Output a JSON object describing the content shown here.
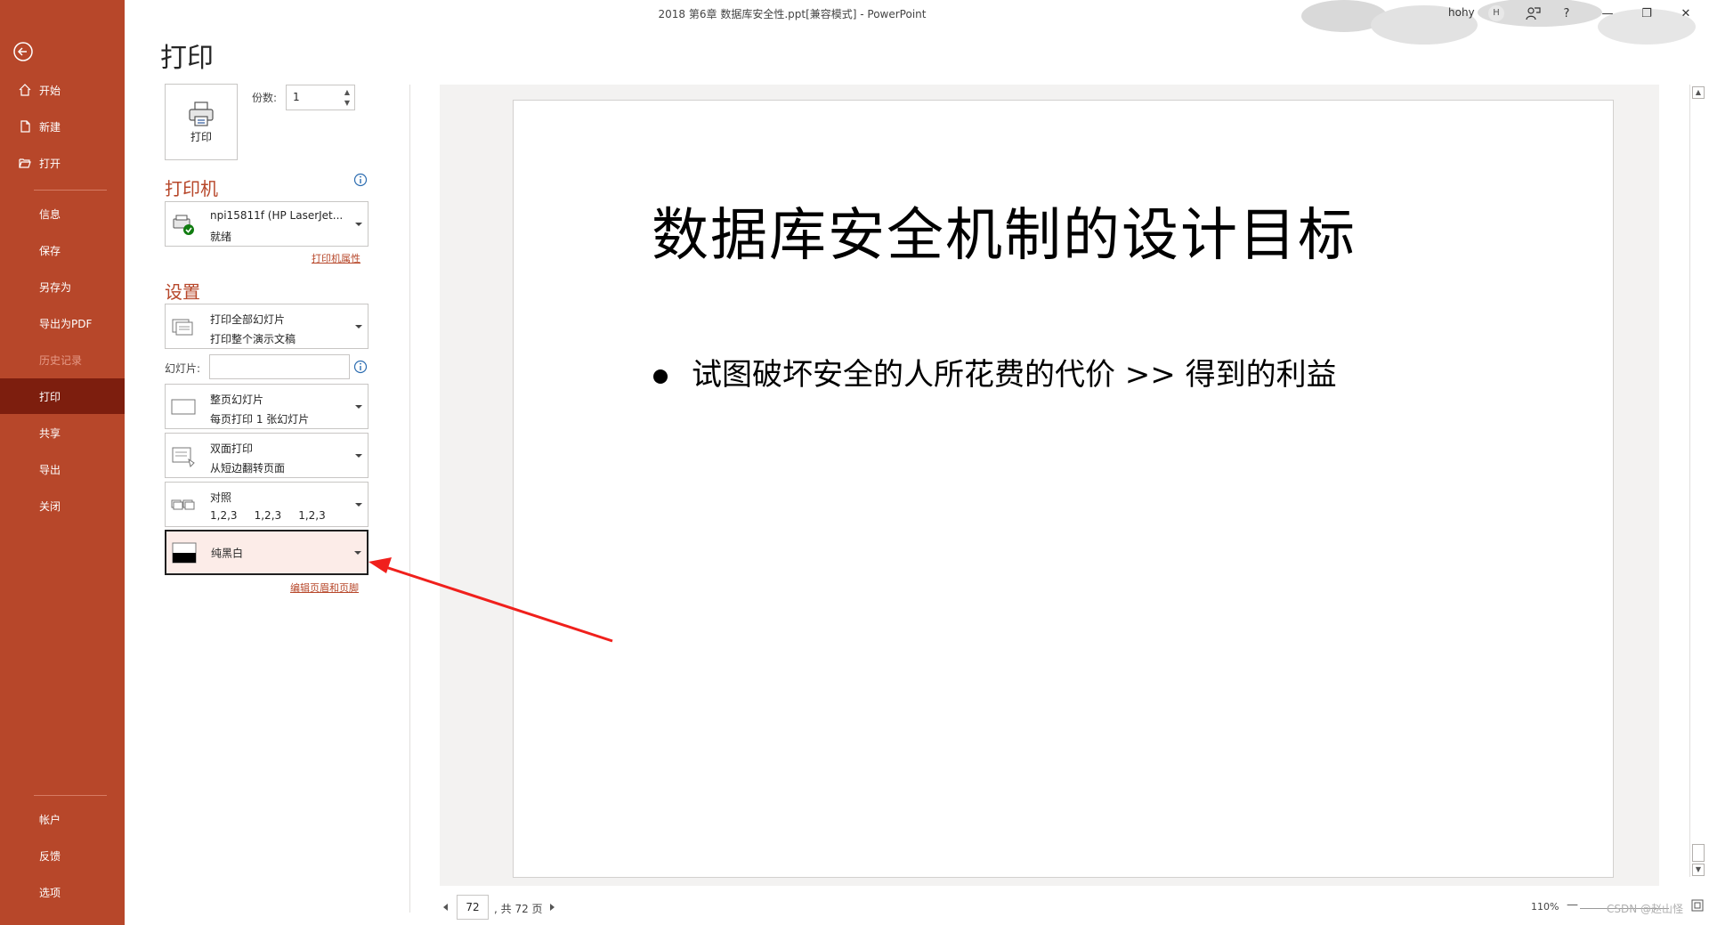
{
  "window": {
    "title": "2018 第6章 数据库安全性.ppt[兼容模式]  -  PowerPoint",
    "user_name": "hohy",
    "user_initial": "H",
    "buttons": {
      "help": "?",
      "minimize": "—",
      "restore": "❐",
      "close": "✕"
    }
  },
  "sidebar": {
    "items": [
      {
        "label": "开始",
        "icon": "home-icon"
      },
      {
        "label": "新建",
        "icon": "new-file-icon"
      },
      {
        "label": "打开",
        "icon": "open-folder-icon"
      },
      {
        "label": "信息"
      },
      {
        "label": "保存"
      },
      {
        "label": "另存为"
      },
      {
        "label": "导出为PDF"
      },
      {
        "label": "历史记录",
        "disabled": true
      },
      {
        "label": "打印",
        "selected": true
      },
      {
        "label": "共享"
      },
      {
        "label": "导出"
      },
      {
        "label": "关闭"
      },
      {
        "label": "帐户"
      },
      {
        "label": "反馈"
      },
      {
        "label": "选项"
      }
    ]
  },
  "print": {
    "page_title": "打印",
    "print_button_label": "打印",
    "copies_label": "份数:",
    "copies_value": "1",
    "printer_section": "打印机",
    "printer": {
      "name": "npi15811f (HP LaserJet...",
      "status": "就绪"
    },
    "printer_properties_link": "打印机属性",
    "settings_section": "设置",
    "settings": {
      "range": {
        "line1": "打印全部幻灯片",
        "line2": "打印整个演示文稿"
      },
      "slides_label": "幻灯片:",
      "slides_value": "",
      "layout": {
        "line1": "整页幻灯片",
        "line2": "每页打印 1 张幻灯片"
      },
      "sides": {
        "line1": "双面打印",
        "line2": "从短边翻转页面"
      },
      "collate": {
        "line1": "对照",
        "line2": "1,2,3     1,2,3     1,2,3"
      },
      "color": {
        "label": "纯黑白"
      }
    },
    "header_footer_link": "编辑页眉和页脚"
  },
  "preview": {
    "slide_title": "数据库安全机制的设计目标",
    "bullet": "试图破坏安全的人所花费的代价  >> 得到的利益"
  },
  "footer": {
    "page_current": "72",
    "page_total": ", 共 72 页",
    "zoom": "110%",
    "zoom_minus": "—",
    "watermark": "CSDN @赵山怪"
  }
}
